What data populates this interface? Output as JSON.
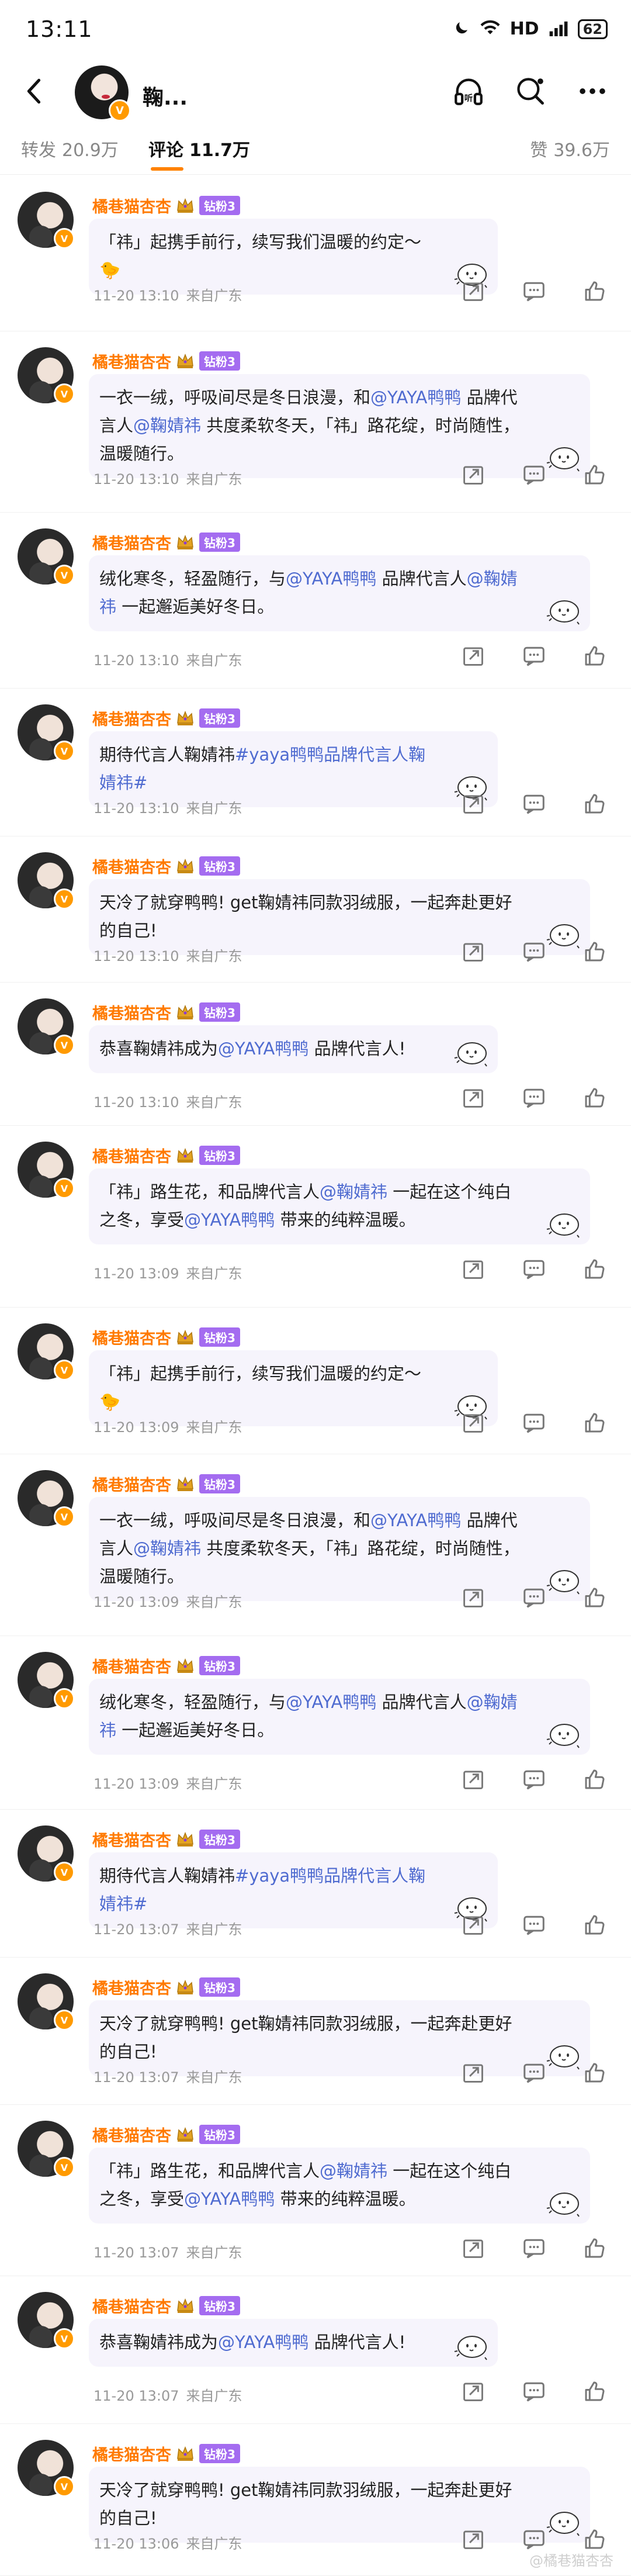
{
  "status": {
    "time": "13:11",
    "network": "HD",
    "battery": "62"
  },
  "header": {
    "title": "鞠..."
  },
  "tabs": [
    {
      "label": "转发",
      "count": "20.9万"
    },
    {
      "label": "评论",
      "count": "11.7万"
    },
    {
      "label": "赞",
      "count": "39.6万"
    }
  ],
  "comments": [
    {
      "user": "橘巷猫杏杏",
      "badge": "钻粉3",
      "parts": [
        {
          "t": "「祎」起携手前行，续写我们温暖的约定～"
        }
      ],
      "emoji": "🐤",
      "time": "11-20 13:10",
      "location": "来自广东"
    },
    {
      "user": "橘巷猫杏杏",
      "badge": "钻粉3",
      "parts": [
        {
          "t": "一衣一绒，呼吸间尽是冬日浪漫，和"
        },
        {
          "t": "@YAYA鸭鸭",
          "m": true
        },
        {
          "t": " 品牌代言人"
        },
        {
          "t": "@鞠婧祎",
          "m": true
        },
        {
          "t": " 共度柔软冬天，「祎」路花绽，时尚随性，温暖随行。"
        }
      ],
      "time": "11-20 13:10",
      "location": "来自广东"
    },
    {
      "user": "橘巷猫杏杏",
      "badge": "钻粉3",
      "parts": [
        {
          "t": "绒化寒冬，轻盈随行，与"
        },
        {
          "t": "@YAYA鸭鸭",
          "m": true
        },
        {
          "t": " 品牌代言人"
        },
        {
          "t": "@鞠婧祎",
          "m": true
        },
        {
          "t": " 一起邂逅美好冬日。"
        }
      ],
      "time": "11-20 13:10",
      "location": "来自广东"
    },
    {
      "user": "橘巷猫杏杏",
      "badge": "钻粉3",
      "parts": [
        {
          "t": "期待代言人鞠婧祎"
        },
        {
          "t": "#yaya鸭鸭品牌代言人鞠婧祎#",
          "m": true
        }
      ],
      "time": "11-20 13:10",
      "location": "来自广东"
    },
    {
      "user": "橘巷猫杏杏",
      "badge": "钻粉3",
      "parts": [
        {
          "t": "天冷了就穿鸭鸭! get鞠婧祎同款羽绒服，一起奔赴更好的自己!"
        }
      ],
      "time": "11-20 13:10",
      "location": "来自广东"
    },
    {
      "user": "橘巷猫杏杏",
      "badge": "钻粉3",
      "parts": [
        {
          "t": "恭喜鞠婧祎成为"
        },
        {
          "t": "@YAYA鸭鸭",
          "m": true
        },
        {
          "t": " 品牌代言人!"
        }
      ],
      "time": "11-20 13:10",
      "location": "来自广东"
    },
    {
      "user": "橘巷猫杏杏",
      "badge": "钻粉3",
      "parts": [
        {
          "t": "「祎」路生花，和品牌代言人"
        },
        {
          "t": "@鞠婧祎",
          "m": true
        },
        {
          "t": " 一起在这个纯白之冬，享受"
        },
        {
          "t": "@YAYA鸭鸭",
          "m": true
        },
        {
          "t": " 带来的纯粹温暖。"
        }
      ],
      "time": "11-20 13:09",
      "location": "来自广东"
    },
    {
      "user": "橘巷猫杏杏",
      "badge": "钻粉3",
      "parts": [
        {
          "t": "「祎」起携手前行，续写我们温暖的约定～"
        }
      ],
      "emoji": "🐤",
      "time": "11-20 13:09",
      "location": "来自广东"
    },
    {
      "user": "橘巷猫杏杏",
      "badge": "钻粉3",
      "parts": [
        {
          "t": "一衣一绒，呼吸间尽是冬日浪漫，和"
        },
        {
          "t": "@YAYA鸭鸭",
          "m": true
        },
        {
          "t": " 品牌代言人"
        },
        {
          "t": "@鞠婧祎",
          "m": true
        },
        {
          "t": " 共度柔软冬天，「祎」路花绽，时尚随性，温暖随行。"
        }
      ],
      "time": "11-20 13:09",
      "location": "来自广东"
    },
    {
      "user": "橘巷猫杏杏",
      "badge": "钻粉3",
      "parts": [
        {
          "t": "绒化寒冬，轻盈随行，与"
        },
        {
          "t": "@YAYA鸭鸭",
          "m": true
        },
        {
          "t": " 品牌代言人"
        },
        {
          "t": "@鞠婧祎",
          "m": true
        },
        {
          "t": " 一起邂逅美好冬日。"
        }
      ],
      "time": "11-20 13:09",
      "location": "来自广东"
    },
    {
      "user": "橘巷猫杏杏",
      "badge": "钻粉3",
      "parts": [
        {
          "t": "期待代言人鞠婧祎"
        },
        {
          "t": "#yaya鸭鸭品牌代言人鞠婧祎#",
          "m": true
        }
      ],
      "time": "11-20 13:07",
      "location": "来自广东"
    },
    {
      "user": "橘巷猫杏杏",
      "badge": "钻粉3",
      "parts": [
        {
          "t": "天冷了就穿鸭鸭! get鞠婧祎同款羽绒服，一起奔赴更好的自己!"
        }
      ],
      "time": "11-20 13:07",
      "location": "来自广东"
    },
    {
      "user": "橘巷猫杏杏",
      "badge": "钻粉3",
      "parts": [
        {
          "t": "「祎」路生花，和品牌代言人"
        },
        {
          "t": "@鞠婧祎",
          "m": true
        },
        {
          "t": " 一起在这个纯白之冬，享受"
        },
        {
          "t": "@YAYA鸭鸭",
          "m": true
        },
        {
          "t": " 带来的纯粹温暖。"
        }
      ],
      "time": "11-20 13:07",
      "location": "来自广东"
    },
    {
      "user": "橘巷猫杏杏",
      "badge": "钻粉3",
      "parts": [
        {
          "t": "恭喜鞠婧祎成为"
        },
        {
          "t": "@YAYA鸭鸭",
          "m": true
        },
        {
          "t": " 品牌代言人!"
        }
      ],
      "time": "11-20 13:07",
      "location": "来自广东"
    },
    {
      "user": "橘巷猫杏杏",
      "badge": "钻粉3",
      "parts": [
        {
          "t": "天冷了就穿鸭鸭! get鞠婧祎同款羽绒服，一起奔赴更好的自己!"
        }
      ],
      "time": "11-20 13:06",
      "location": "来自广东"
    }
  ],
  "icons": {
    "back": "back-icon",
    "listen": "listen-icon",
    "search": "search-icon",
    "more": "more-icon",
    "share": "share-icon",
    "comment": "comment-icon",
    "like": "like-icon"
  },
  "colors": {
    "accent": "#ff8200",
    "mention": "#4f6bd0",
    "username": "#ff7a00",
    "badge": "#a46cf0",
    "bubble": "#f6f4fc"
  },
  "watermark": "@橘巷猫杏杏"
}
